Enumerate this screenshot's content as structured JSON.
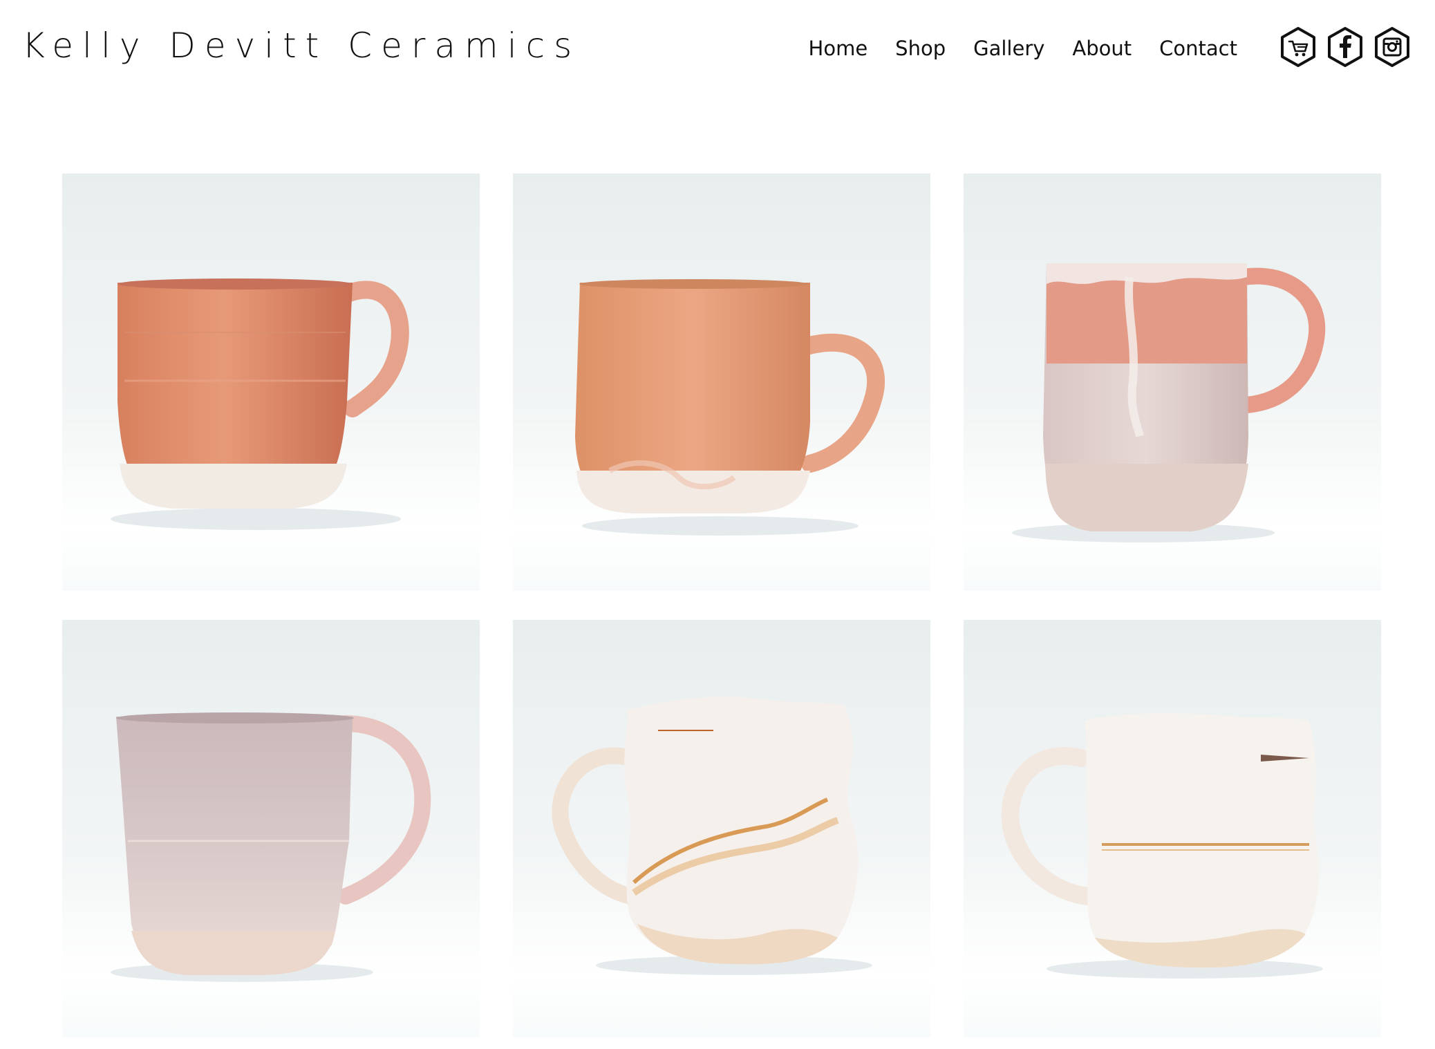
{
  "site": {
    "title": "Kelly Devitt Ceramics"
  },
  "nav": {
    "items": [
      {
        "label": "Home"
      },
      {
        "label": "Shop"
      },
      {
        "label": "Gallery"
      },
      {
        "label": "About"
      },
      {
        "label": "Contact"
      }
    ]
  },
  "social": [
    {
      "icon": "cart-icon"
    },
    {
      "icon": "facebook-icon"
    },
    {
      "icon": "instagram-icon"
    }
  ],
  "gallery": {
    "images": [
      {
        "subject": "coral-glazed-mug",
        "handle": "right"
      },
      {
        "subject": "peach-glazed-mug",
        "handle": "right"
      },
      {
        "subject": "pink-drip-mug",
        "handle": "right"
      },
      {
        "subject": "lavender-mug",
        "handle": "right"
      },
      {
        "subject": "white-sgraffito-mug",
        "handle": "left"
      },
      {
        "subject": "white-etched-mug",
        "handle": "left"
      }
    ]
  },
  "colors": {
    "text": "#111111",
    "background": "#ffffff",
    "backdrop": "#eaf0f0"
  }
}
